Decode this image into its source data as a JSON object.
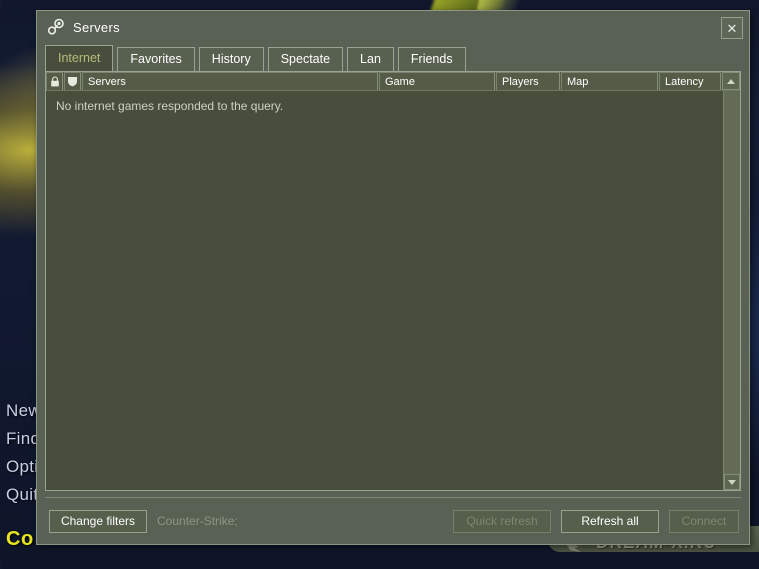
{
  "window": {
    "title": "Servers",
    "icon": "steam-icon",
    "close_label": "✕"
  },
  "tabs": [
    {
      "label": "Internet",
      "active": true
    },
    {
      "label": "Favorites",
      "active": false
    },
    {
      "label": "History",
      "active": false
    },
    {
      "label": "Spectate",
      "active": false
    },
    {
      "label": "Lan",
      "active": false
    },
    {
      "label": "Friends",
      "active": false
    }
  ],
  "table": {
    "columns": [
      {
        "label": "",
        "icon": "lock-icon"
      },
      {
        "label": "",
        "icon": "shield-icon"
      },
      {
        "label": "Servers",
        "icon": ""
      },
      {
        "label": "Game",
        "icon": ""
      },
      {
        "label": "Players",
        "icon": ""
      },
      {
        "label": "Map",
        "icon": ""
      },
      {
        "label": "Latency",
        "icon": ""
      }
    ],
    "rows": [],
    "empty_message": "No internet games responded to the query."
  },
  "footer": {
    "change_filters_label": "Change filters",
    "filter_summary": "Counter-Strike;",
    "quick_refresh_label": "Quick refresh",
    "refresh_all_label": "Refresh all",
    "connect_label": "Connect",
    "quick_refresh_enabled": false,
    "refresh_all_enabled": true,
    "connect_enabled": false
  },
  "background_menu": {
    "items": [
      "New",
      "Find",
      "Opti",
      "Quit"
    ],
    "console_label": "Co"
  },
  "watermark": {
    "text": "DREAM-X.RU"
  },
  "colors": {
    "dialog_titlebar": "#586154",
    "content_bg": "#474e3b",
    "border": "#9aa290",
    "active_tab_text": "#b9bb7d",
    "disabled_text": "#7e876f",
    "console_yellow": "#e8e520"
  }
}
